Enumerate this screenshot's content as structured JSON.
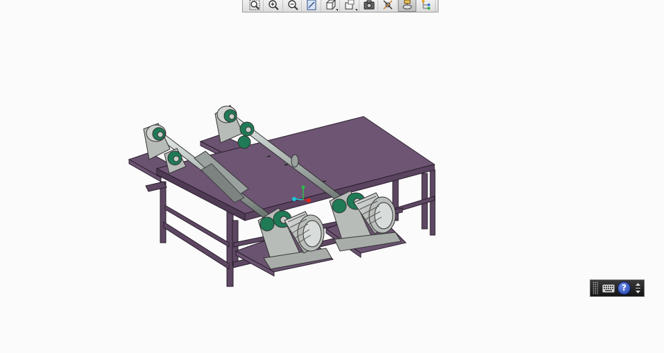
{
  "toolbar": {
    "buttons": [
      {
        "name": "fit-all",
        "icon": "magnifier-fit-icon"
      },
      {
        "name": "zoom-in",
        "icon": "zoom-in-icon"
      },
      {
        "name": "zoom-out",
        "icon": "zoom-out-icon"
      },
      {
        "name": "normal-view",
        "icon": "normal-view-icon"
      },
      {
        "name": "view-mode",
        "icon": "cube-icon"
      },
      {
        "name": "render-style",
        "icon": "render-style-icon"
      },
      {
        "name": "capture",
        "icon": "camera-icon"
      },
      {
        "name": "hide-show",
        "icon": "hide-show-icon"
      },
      {
        "name": "swap-visible",
        "icon": "swap-visible-icon"
      },
      {
        "name": "tree",
        "icon": "tree-icon"
      }
    ]
  },
  "mini_toolbar": {
    "help_label": "?"
  },
  "colors": {
    "table_top": "#6e5574",
    "table_frame": "#5d4762",
    "bearing_block": "#b8bcb9",
    "seal_green": "#1f7a56",
    "shaft": "#b2bab6",
    "motor": "#b9beba"
  }
}
